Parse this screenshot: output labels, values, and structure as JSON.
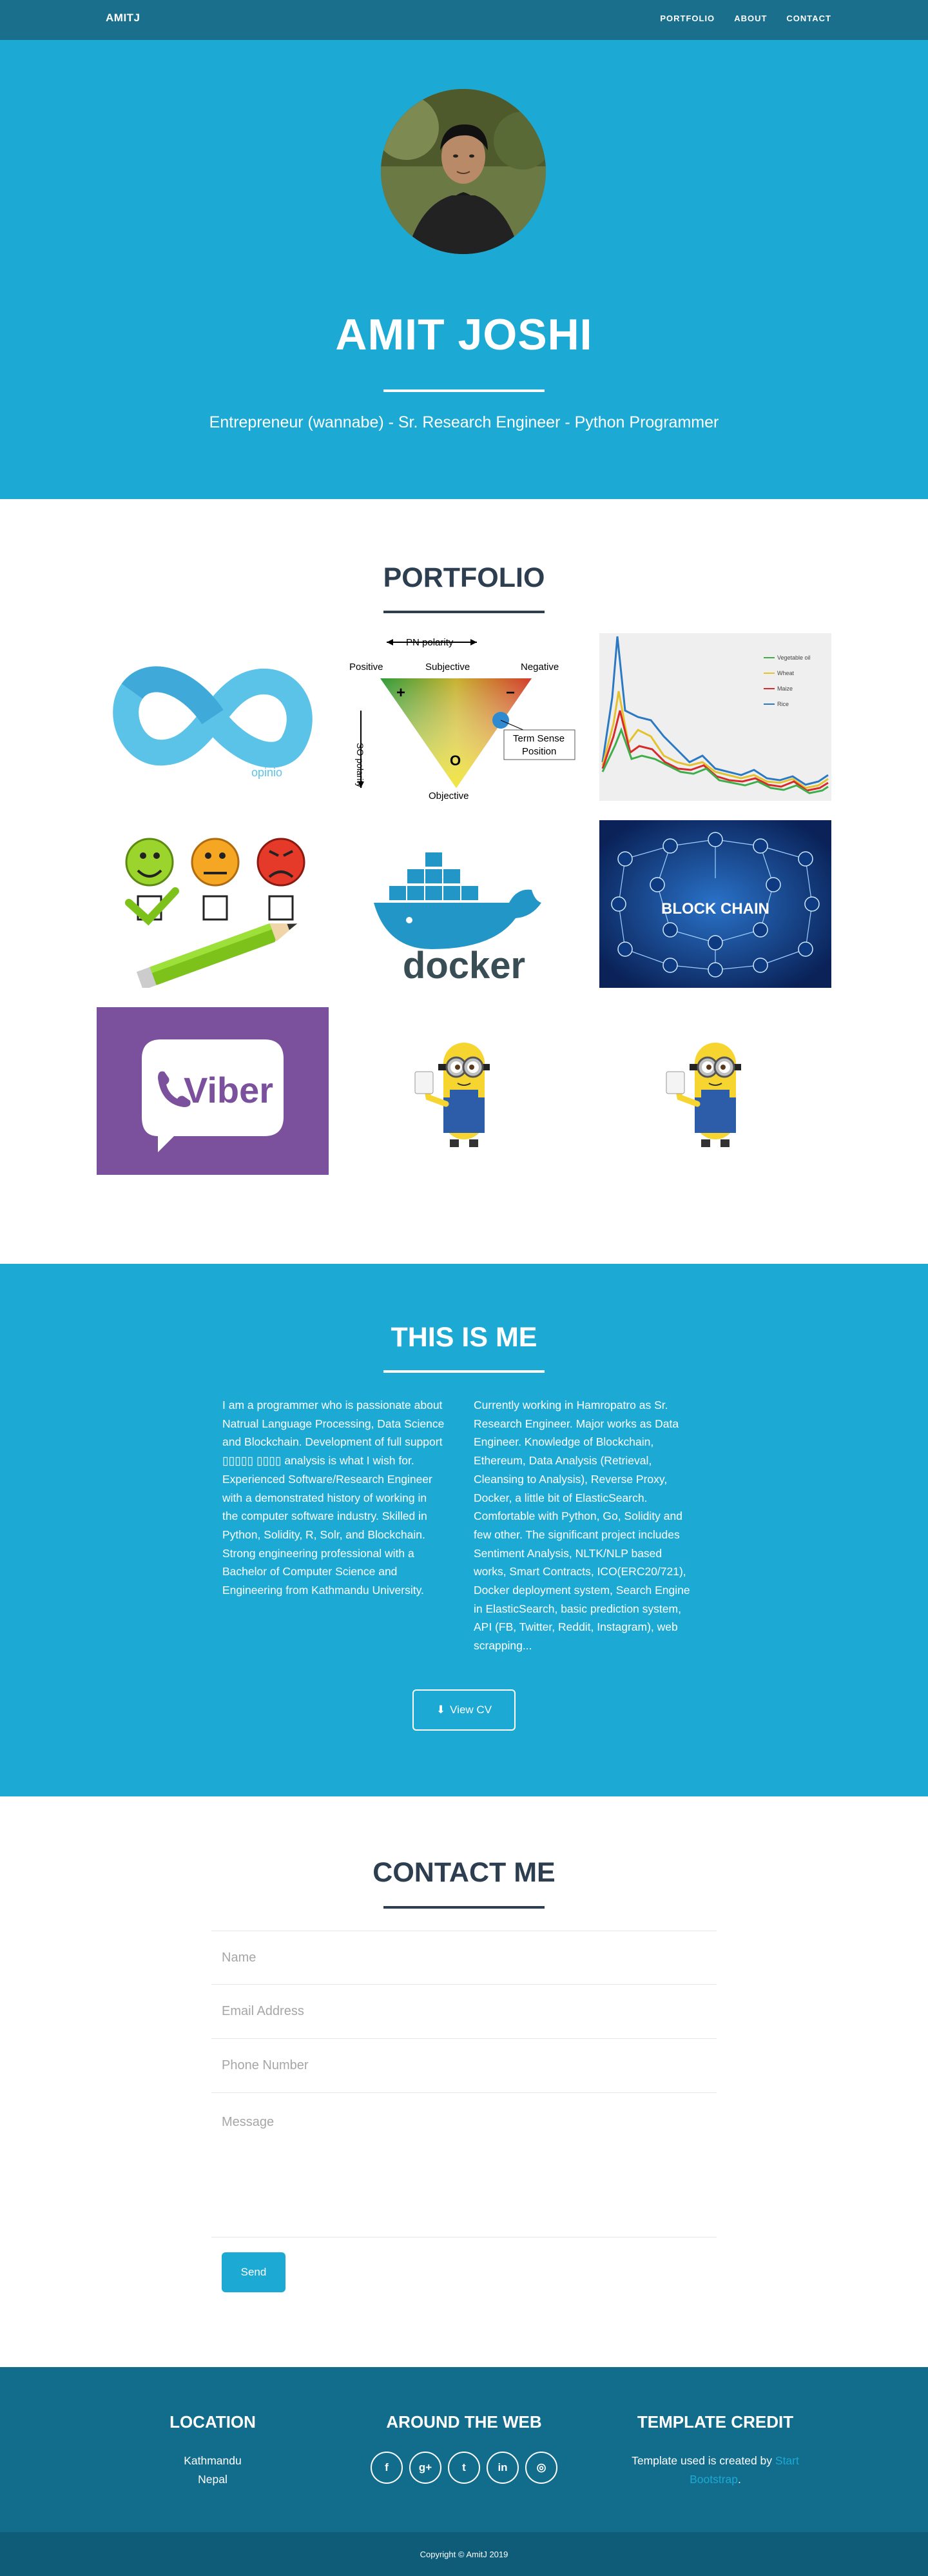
{
  "nav": {
    "brand": "AMITJ",
    "links": [
      "PORTFOLIO",
      "ABOUT",
      "CONTACT"
    ]
  },
  "hero": {
    "name": "AMIT JOSHI",
    "tagline": "Entrepreneur (wannabe) - Sr. Research Engineer - Python Programmer"
  },
  "portfolio": {
    "title": "PORTFOLIO",
    "items": [
      {
        "name": "opinio-logo",
        "label": "opinio"
      },
      {
        "name": "pn-polarity-triangle",
        "top": "PN polarity",
        "pos": "Positive",
        "subj": "Subjective",
        "neg": "Negative",
        "obj": "Objective",
        "so": "SO polarity",
        "term": "Term Sense",
        "termpos": "Position",
        "plus": "+",
        "minus": "−",
        "o": "O"
      },
      {
        "name": "price-line-chart",
        "legend": [
          "Vegetable oil",
          "Wheat",
          "Maize",
          "Rice"
        ]
      },
      {
        "name": "feedback-smileys"
      },
      {
        "name": "docker-logo",
        "label": "docker"
      },
      {
        "name": "block-chain",
        "label": "BLOCK CHAIN"
      },
      {
        "name": "viber-logo",
        "label": "Viber"
      },
      {
        "name": "minion-1"
      },
      {
        "name": "minion-2"
      }
    ]
  },
  "about": {
    "title": "THIS IS ME",
    "left": "I am a programmer who is passionate about Natrual Language Processing, Data Science and Blockchain. Development of full support ▯▯▯▯▯ ▯▯▯▯ analysis is what I wish for. Experienced Software/Research Engineer with a demonstrated history of working in the computer software industry. Skilled in Python, Solidity, R, Solr, and Blockchain. Strong engineering professional with a Bachelor of Computer Science and Engineering from Kathmandu University.",
    "right": "Currently working in Hamropatro as Sr. Research Engineer. Major works as Data Engineer. Knowledge of Blockchain, Ethereum, Data Analysis (Retrieval, Cleansing to Analysis), Reverse Proxy, Docker, a little bit of ElasticSearch. Comfortable with Python, Go, Solidity and few other. The significant project includes Sentiment Analysis, NLTK/NLP based works, Smart Contracts, ICO(ERC20/721), Docker deployment system, Search Engine in ElasticSearch, basic prediction system, API (FB, Twitter, Reddit, Instagram), web scrapping...",
    "cv_button": "View CV"
  },
  "contact": {
    "title": "CONTACT ME",
    "name_placeholder": "Name",
    "email_placeholder": "Email Address",
    "phone_placeholder": "Phone Number",
    "message_placeholder": "Message",
    "send": "Send"
  },
  "footer": {
    "location_title": "LOCATION",
    "location_line1": "Kathmandu",
    "location_line2": "Nepal",
    "web_title": "AROUND THE WEB",
    "social_icons": [
      "facebook-icon",
      "google-plus-icon",
      "twitter-icon",
      "linkedin-icon",
      "github-icon"
    ],
    "social_glyphs": [
      "f",
      "g+",
      "t",
      "in",
      "◎"
    ],
    "credit_title": "TEMPLATE CREDIT",
    "credit_text": "Template used is created by ",
    "credit_link": "Start Bootstrap",
    "credit_end": ".",
    "copyright": "Copyright © AmitJ 2019"
  },
  "colors": {
    "primary": "#1ca9d3",
    "nav": "#1a6f8d",
    "dark": "#2c3e50",
    "footer": "#126d8d",
    "copyright": "#0f5c78"
  }
}
